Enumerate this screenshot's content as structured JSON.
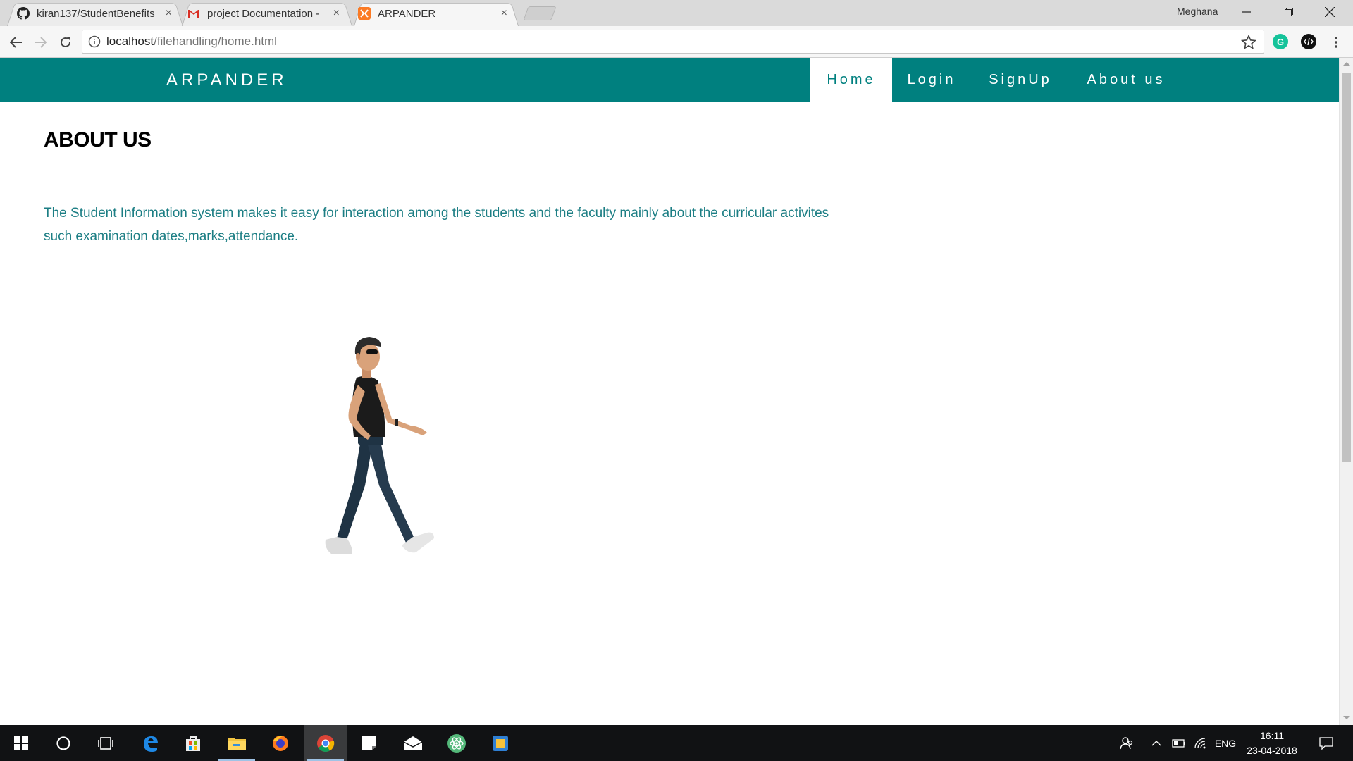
{
  "browser": {
    "tabs": [
      {
        "title": "kiran137/StudentBenefits",
        "icon": "github-icon"
      },
      {
        "title": "project Documentation -",
        "icon": "gmail-icon"
      },
      {
        "title": "ARPANDER",
        "icon": "xampp-icon"
      }
    ],
    "active_tab": 2,
    "profile_name": "Meghana",
    "close_glyph": "×",
    "address": {
      "host": "localhost",
      "path": "/filehandling/home.html"
    }
  },
  "site": {
    "brand": "ARPANDER",
    "nav": [
      {
        "label": "Home",
        "active": true
      },
      {
        "label": "Login",
        "active": false
      },
      {
        "label": "SignUp",
        "active": false
      },
      {
        "label": "About us",
        "active": false
      }
    ],
    "heading": "ABOUT US",
    "paragraph": "The Student Information system makes it easy for interaction among the students and the faculty mainly about the curricular activites such examination dates,marks,attendance.",
    "accent_color": "#00807f",
    "text_color": "#1c7e84"
  },
  "taskbar": {
    "apps": [
      "windows-start-icon",
      "cortana-icon",
      "task-view-icon",
      "edge-icon",
      "store-icon",
      "file-explorer-icon",
      "firefox-icon",
      "chrome-icon",
      "sticky-notes-icon",
      "mail-icon",
      "atom-icon",
      "virtualbox-icon"
    ],
    "active_app": "chrome-icon",
    "language": "ENG",
    "time": "16:11",
    "date": "23-04-2018"
  }
}
